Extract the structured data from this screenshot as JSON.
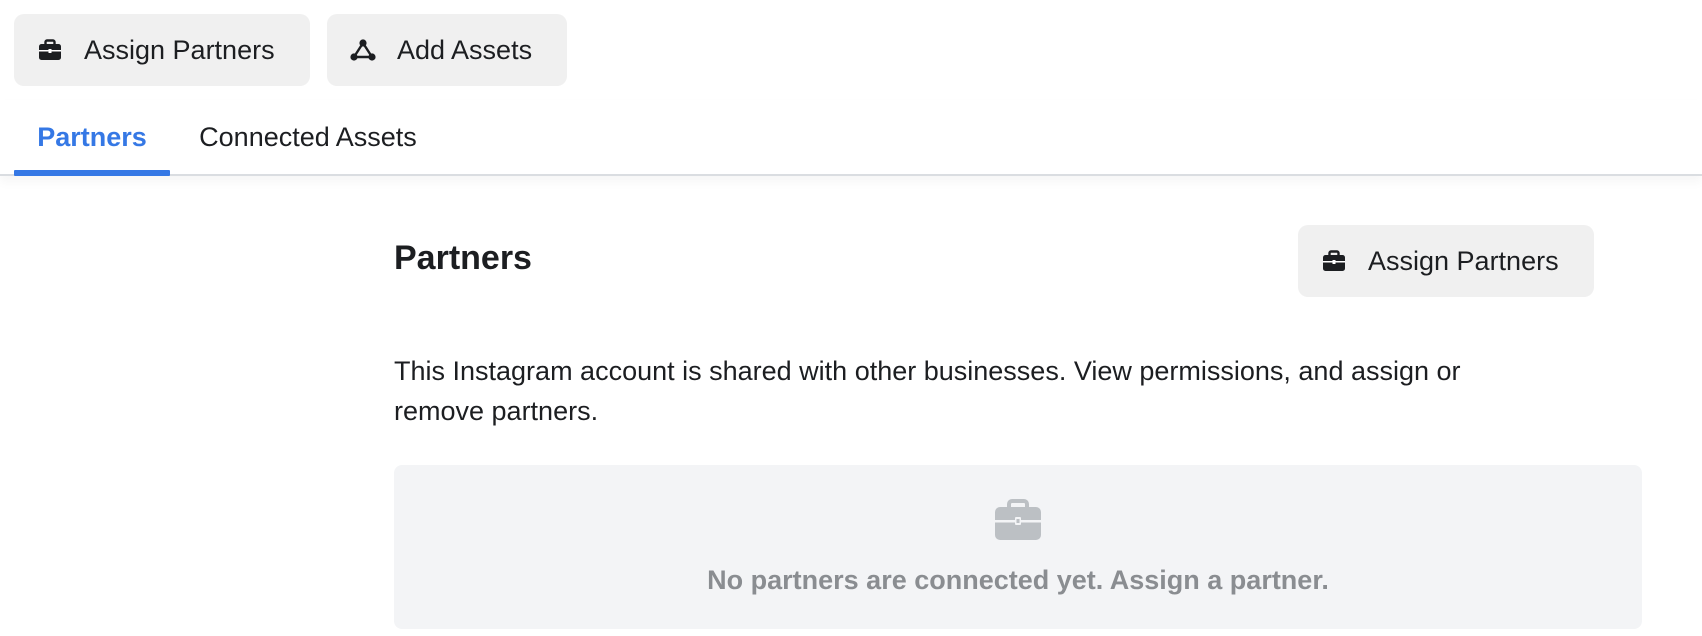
{
  "toolbar": {
    "assign_partners_label": "Assign Partners",
    "add_assets_label": "Add Assets"
  },
  "tabs": [
    {
      "label": "Partners",
      "active": true
    },
    {
      "label": "Connected Assets",
      "active": false
    }
  ],
  "section": {
    "title": "Partners",
    "assign_partners_label": "Assign Partners",
    "description": "This Instagram account is shared with other businesses. View permissions, and assign or remove partners."
  },
  "empty_state": {
    "message": "No partners are connected yet. Assign a partner.",
    "icon": "briefcase-icon"
  },
  "colors": {
    "accent": "#3578e5",
    "text": "#1c1e21",
    "muted": "#8a8d91",
    "button_bg": "#f0f0f0",
    "empty_bg": "#f3f4f6"
  }
}
